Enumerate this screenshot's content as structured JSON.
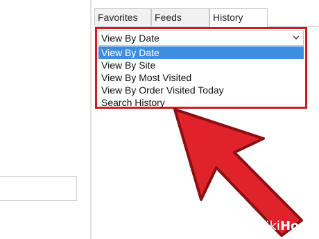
{
  "tabs": [
    {
      "label": "Favorites"
    },
    {
      "label": "Feeds"
    },
    {
      "label": "History"
    }
  ],
  "history": {
    "view_select": {
      "value": "View By Date"
    },
    "options": [
      {
        "label": "View By Date",
        "selected": true
      },
      {
        "label": "View By Site"
      },
      {
        "label": "View By Most Visited"
      },
      {
        "label": "View By Order Visited Today"
      },
      {
        "label": "Search History"
      }
    ]
  },
  "annotation": {
    "highlight_color": "#d11a1e",
    "arrow_color": "#e0232a"
  },
  "watermark": {
    "wiki": "wiki",
    "how": "How"
  },
  "icons": {
    "dropdown": "chevron-down-icon"
  }
}
